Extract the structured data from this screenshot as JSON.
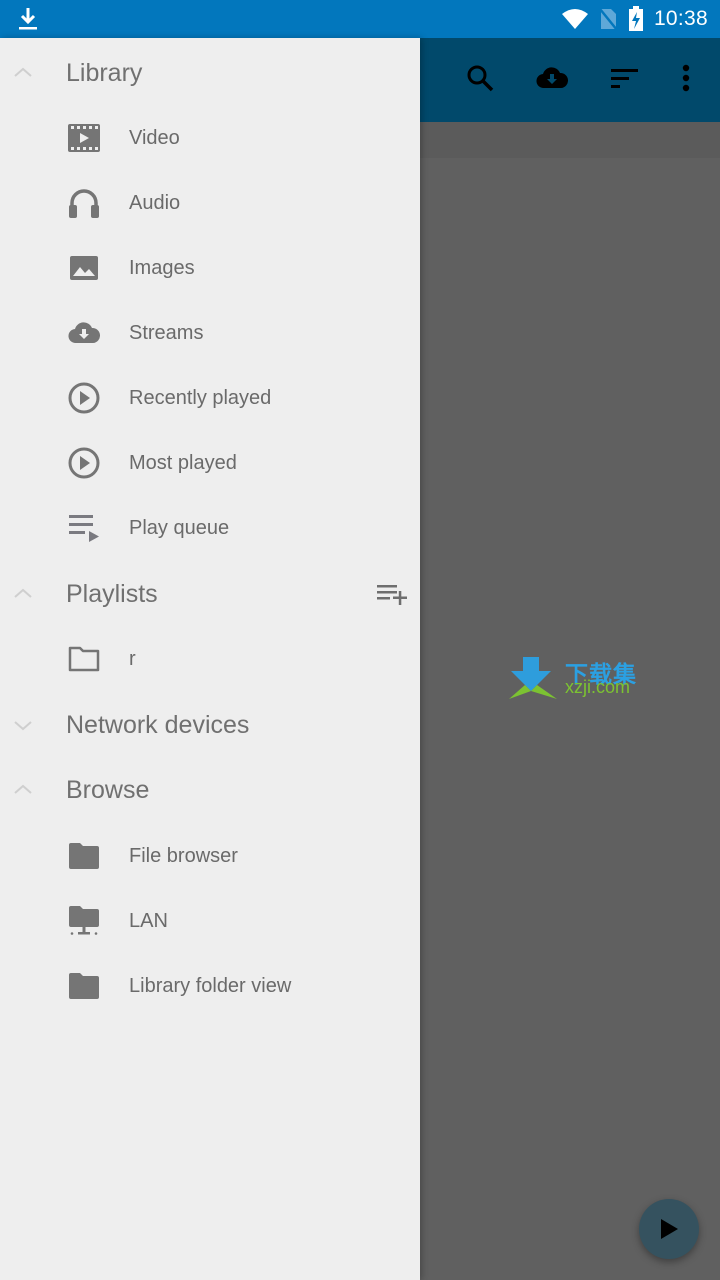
{
  "status_bar": {
    "time": "10:38",
    "icons": [
      "download-icon",
      "wifi-icon",
      "no-sim-icon",
      "battery-charging-icon"
    ],
    "color": "#0277bd"
  },
  "app_toolbar": {
    "color": "#01496b",
    "actions": [
      {
        "name": "search",
        "icon": "search-icon"
      },
      {
        "name": "streams",
        "icon": "cloud-download-icon"
      },
      {
        "name": "sort",
        "icon": "sort-icon"
      },
      {
        "name": "more",
        "icon": "more-vert-icon"
      }
    ]
  },
  "drawer": {
    "sections": [
      {
        "title": "Library",
        "expanded": true,
        "items": [
          {
            "label": "Video",
            "icon": "movie-icon"
          },
          {
            "label": "Audio",
            "icon": "headphones-icon"
          },
          {
            "label": "Images",
            "icon": "image-icon"
          },
          {
            "label": "Streams",
            "icon": "cloud-download-icon"
          },
          {
            "label": "Recently played",
            "icon": "play-circle-icon"
          },
          {
            "label": "Most played",
            "icon": "play-circle-icon"
          },
          {
            "label": "Play queue",
            "icon": "playlist-play-icon"
          }
        ]
      },
      {
        "title": "Playlists",
        "expanded": true,
        "action_icon": "playlist-add-icon",
        "items": [
          {
            "label": "r",
            "icon": "folder-outline-icon"
          }
        ]
      },
      {
        "title": "Network devices",
        "expanded": false,
        "items": []
      },
      {
        "title": "Browse",
        "expanded": true,
        "items": [
          {
            "label": "File browser",
            "icon": "folder-icon"
          },
          {
            "label": "LAN",
            "icon": "folder-network-icon"
          },
          {
            "label": "Library folder view",
            "icon": "folder-icon"
          }
        ]
      }
    ]
  },
  "fab": {
    "icon": "play-icon",
    "color": "#35525f"
  },
  "watermark": {
    "cn": "下载集",
    "en": "xzji.com"
  }
}
